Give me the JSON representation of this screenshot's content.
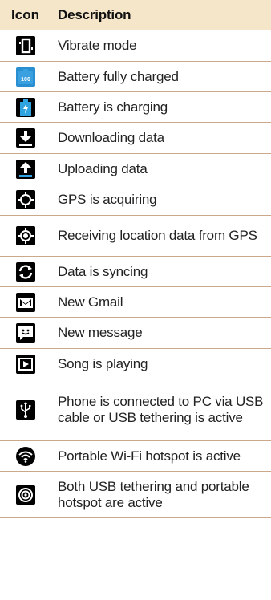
{
  "header": {
    "icon_col": "Icon",
    "desc_col": "Description"
  },
  "rows": [
    {
      "icon": "vibrate-icon",
      "label": "Vibrate mode"
    },
    {
      "icon": "battery-full-icon",
      "label": "Battery fully charged",
      "icon_text": "100"
    },
    {
      "icon": "battery-charging-icon",
      "label": "Battery is charging"
    },
    {
      "icon": "download-icon",
      "label": "Downloading data"
    },
    {
      "icon": "upload-icon",
      "label": "Uploading data"
    },
    {
      "icon": "gps-acquiring-icon",
      "label": "GPS is acquiring"
    },
    {
      "icon": "gps-location-icon",
      "label": "Receiving location data from GPS"
    },
    {
      "icon": "sync-icon",
      "label": "Data is syncing"
    },
    {
      "icon": "gmail-icon",
      "label": "New Gmail"
    },
    {
      "icon": "message-icon",
      "label": "New message"
    },
    {
      "icon": "play-icon",
      "label": "Song is playing"
    },
    {
      "icon": "usb-icon",
      "label": "Phone is connected to PC via USB cable or USB tethering is active"
    },
    {
      "icon": "wifi-hotspot-icon",
      "label": "Portable Wi-Fi hotspot is active"
    },
    {
      "icon": "tethering-hotspot-icon",
      "label": "Both USB tethering and portable hotspot are active"
    }
  ]
}
